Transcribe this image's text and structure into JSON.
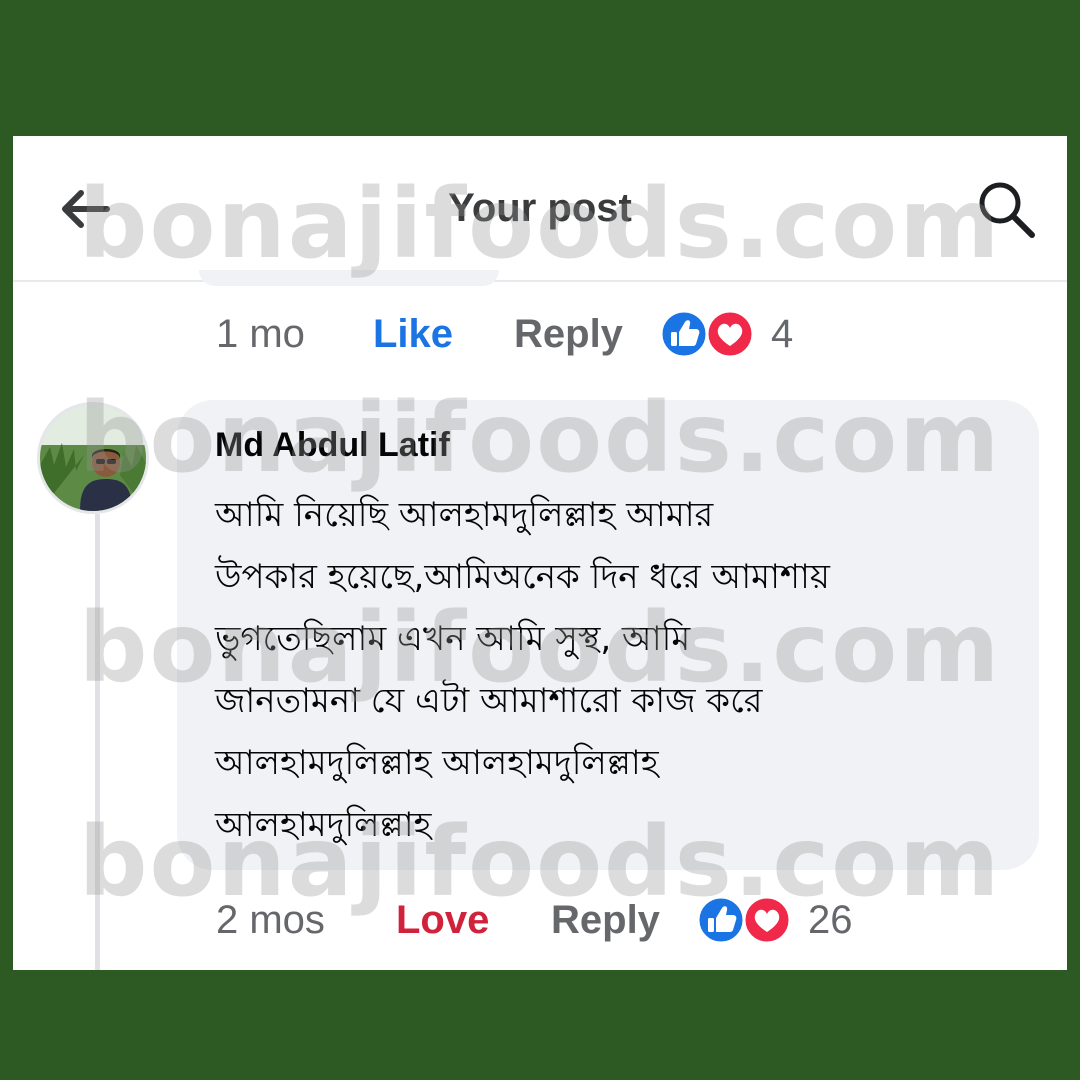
{
  "header": {
    "title": "Your post"
  },
  "prev_comment": {
    "time": "1 mo",
    "action_label": "Like",
    "reply_label": "Reply",
    "reaction_icons": [
      "like-icon",
      "love-icon"
    ],
    "reaction_count": "4"
  },
  "comment": {
    "author": "Md Abdul Latif",
    "avatar_icon": "user-avatar",
    "lines": [
      "আমি নিয়েছি আলহামদুলিল্লাহ  আমার",
      "উপকার হয়েছে,আমিঅনেক দিন ধরে আমাশায়",
      "ভুগতেছিলাম এখন আমি সুস্থ, আমি",
      "জানতামনা যে এটা আমাশারো কাজ করে",
      "আলহামদুলিল্লাহ  আলহামদুলিল্লাহ",
      "আলহামদুলিল্লাহ"
    ],
    "time": "2 mos",
    "action_label": "Love",
    "reply_label": "Reply",
    "reaction_icons": [
      "like-icon",
      "love-icon"
    ],
    "reaction_count": "26"
  },
  "watermark": "bonajifoods.com",
  "colors": {
    "frame": "#2d5a22",
    "like_blue": "#1b74e4",
    "love_red": "#d0233b",
    "meta_gray": "#65676b",
    "bubble": "#f0f2f5"
  }
}
